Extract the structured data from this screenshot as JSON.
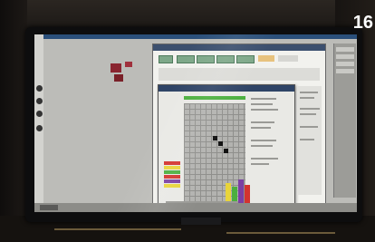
{
  "photo": {
    "slide_number": "16"
  },
  "colors": {
    "screen_bg": "#bcbcb8",
    "window_title": "#3b4f6e",
    "toolbar_button": "#7ea889",
    "bar_red": "#d3332f",
    "bar_yellow": "#e8d43a",
    "bar_green": "#4caf3f",
    "bar_purple": "#7b3fa3"
  },
  "icons": [
    "monitor-bezel",
    "window-icon",
    "toolbar-button-icon"
  ]
}
